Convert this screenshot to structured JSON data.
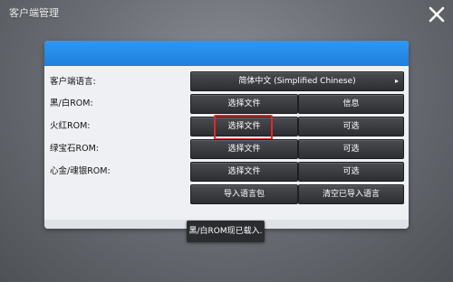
{
  "window": {
    "title": "客户端管理",
    "close_icon": "close-x-icon"
  },
  "form": {
    "rows": [
      {
        "label": "客户端语言:",
        "dropdown_value": "简体中文 (Simplified Chinese)"
      },
      {
        "label": "黑/白ROM:",
        "left_button": "选择文件",
        "right_button": "信息"
      },
      {
        "label": "火红ROM:",
        "left_button": "选择文件",
        "right_button": "可选"
      },
      {
        "label": "绿宝石ROM:",
        "left_button": "选择文件",
        "right_button": "可选"
      },
      {
        "label": "心金/魂银ROM:",
        "left_button": "选择文件",
        "right_button": "可选"
      }
    ],
    "actions": {
      "import_language_pack": "导入语言包",
      "clear_imported_languages": "清空已导入语言"
    }
  },
  "toast": {
    "message": "黑/白ROM现已载入."
  },
  "colors": {
    "header_blue": "#2a8fee",
    "button_dark": "#3a3c40",
    "highlight_red": "#e0282a"
  }
}
